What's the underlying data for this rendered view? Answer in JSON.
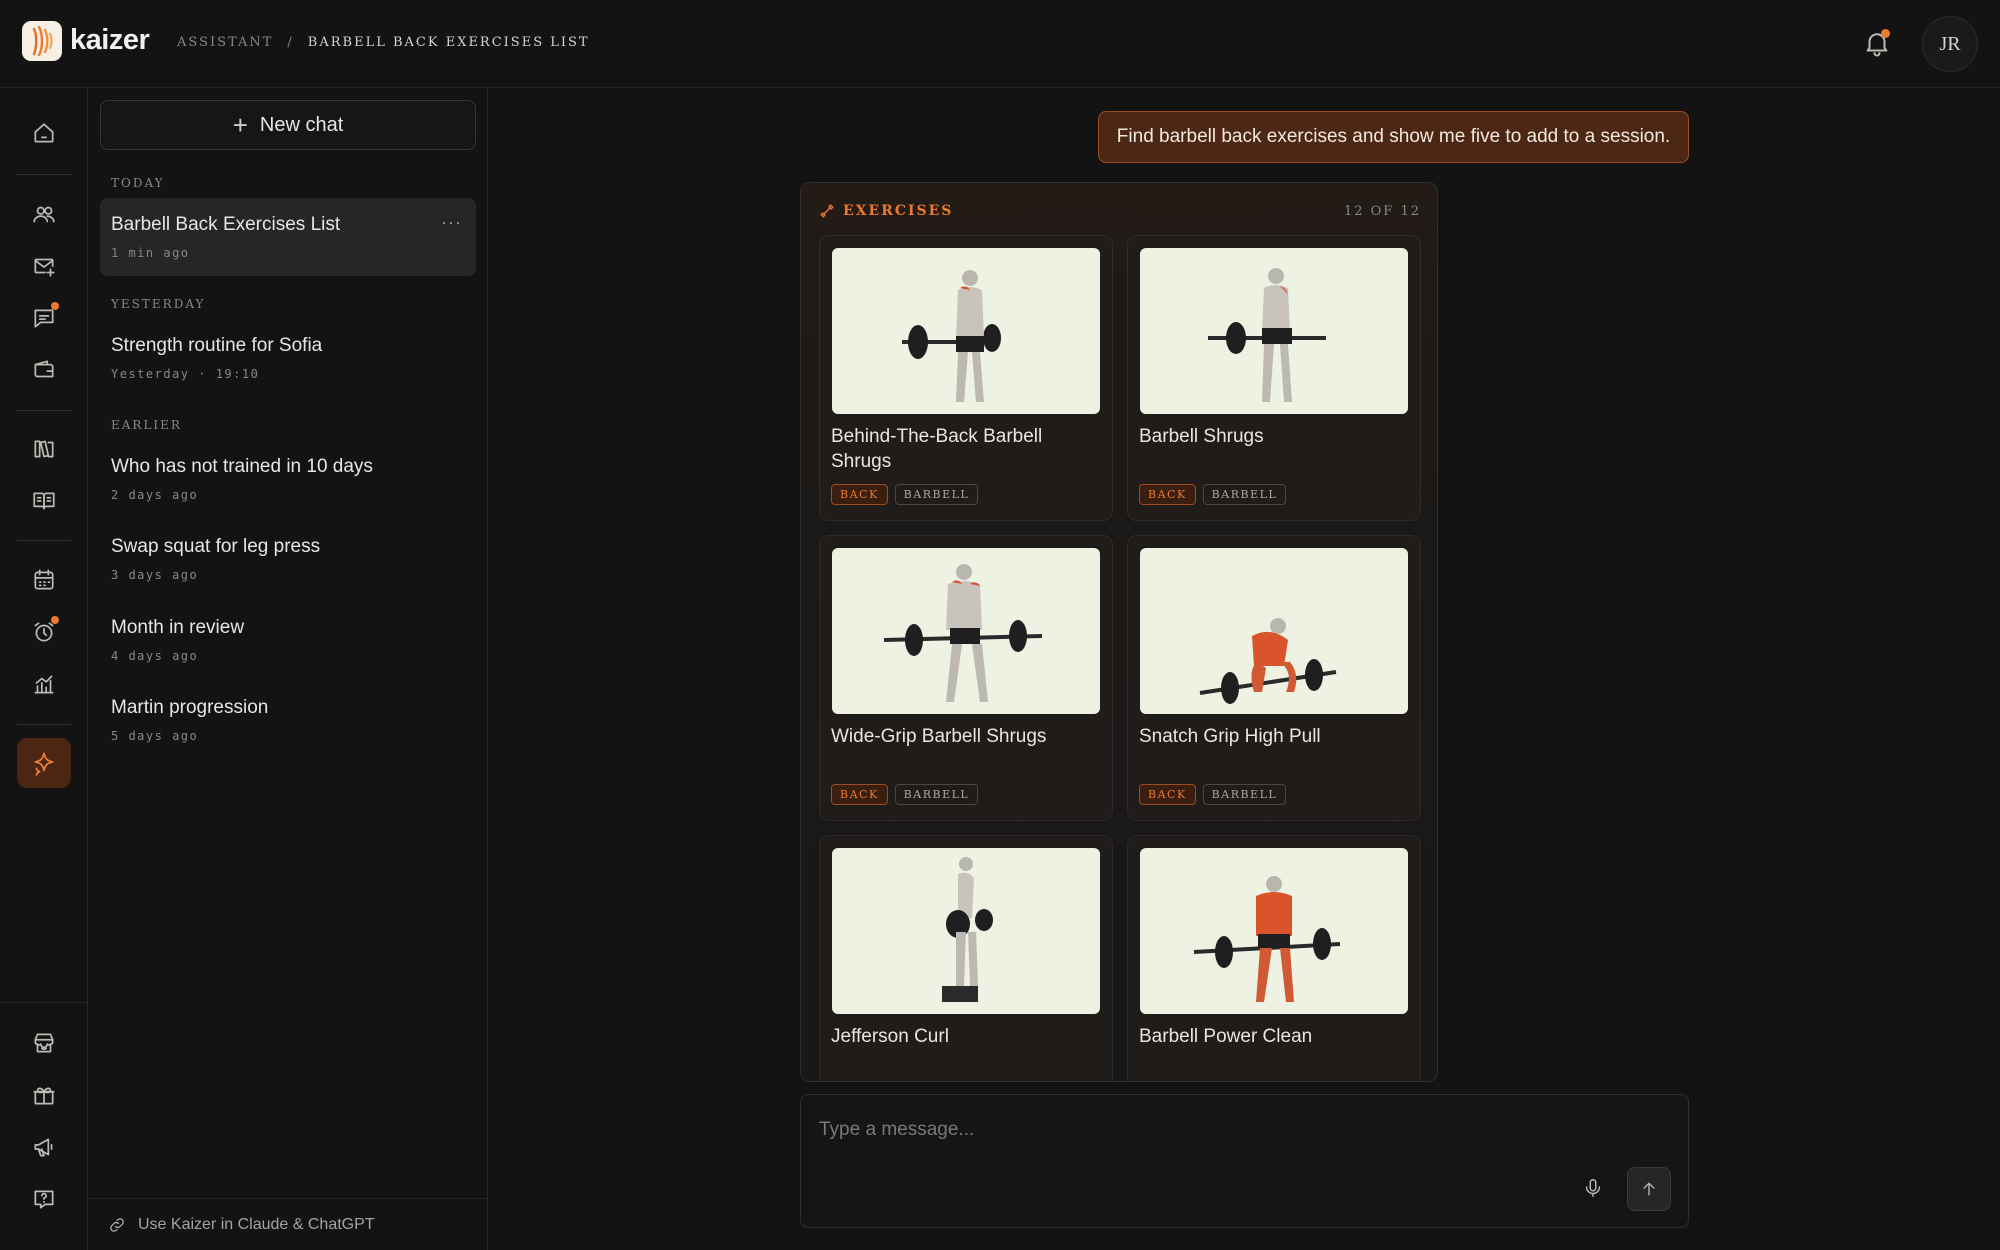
{
  "app": {
    "brand": "kaizer",
    "breadcrumb": [
      "ASSISTANT",
      "BARBELL BACK EXERCISES LIST"
    ],
    "breadcrumb_sep": "/",
    "user_initials": "JR",
    "accent_color": "#ec7a2e"
  },
  "rail": {
    "items": [
      {
        "icon": "home-icon"
      },
      {
        "icon": "users-icon"
      },
      {
        "icon": "mail-plus-icon"
      },
      {
        "icon": "chat-icon",
        "badge": true
      },
      {
        "icon": "wallet-icon"
      },
      {
        "icon": "library-icon"
      },
      {
        "icon": "book-icon"
      },
      {
        "icon": "calendar-icon"
      },
      {
        "icon": "alarm-icon",
        "badge": true
      },
      {
        "icon": "analytics-icon"
      },
      {
        "icon": "sparkle-icon",
        "active": true
      }
    ],
    "bottom_items": [
      {
        "icon": "store-icon"
      },
      {
        "icon": "gift-icon"
      },
      {
        "icon": "megaphone-icon"
      },
      {
        "icon": "help-icon"
      }
    ]
  },
  "sidebar": {
    "new_chat_label": "New chat",
    "sections": [
      {
        "label": "TODAY",
        "items": [
          {
            "title": "Barbell Back Exercises List",
            "time": "1 min ago",
            "active": true
          }
        ]
      },
      {
        "label": "YESTERDAY",
        "items": [
          {
            "title": "Strength routine for Sofia",
            "time": "Yesterday · 19:10"
          }
        ]
      },
      {
        "label": "EARLIER",
        "items": [
          {
            "title": "Who has not trained in 10 days",
            "time": "2 days ago"
          },
          {
            "title": "Swap squat for leg press",
            "time": "3 days ago"
          },
          {
            "title": "Month in review",
            "time": "4 days ago"
          },
          {
            "title": "Martin progression",
            "time": "5 days ago"
          }
        ]
      }
    ],
    "more_label": "···",
    "footer_label": "Use Kaizer in Claude & ChatGPT"
  },
  "conversation": {
    "user_message": "Find barbell back exercises and show me five to add to a session.",
    "exercises_card": {
      "label": "EXERCISES",
      "count": "12 OF 12",
      "items": [
        {
          "name": "Behind-The-Back Barbell Shrugs",
          "tags": [
            "BACK",
            "BARBELL"
          ]
        },
        {
          "name": "Barbell Shrugs",
          "tags": [
            "BACK",
            "BARBELL"
          ]
        },
        {
          "name": "Wide-Grip Barbell Shrugs",
          "tags": [
            "BACK",
            "BARBELL"
          ]
        },
        {
          "name": "Snatch Grip High Pull",
          "tags": [
            "BACK",
            "BARBELL"
          ]
        },
        {
          "name": "Jefferson Curl",
          "tags": []
        },
        {
          "name": "Barbell Power Clean",
          "tags": []
        }
      ]
    }
  },
  "composer": {
    "placeholder": "Type a message..."
  }
}
